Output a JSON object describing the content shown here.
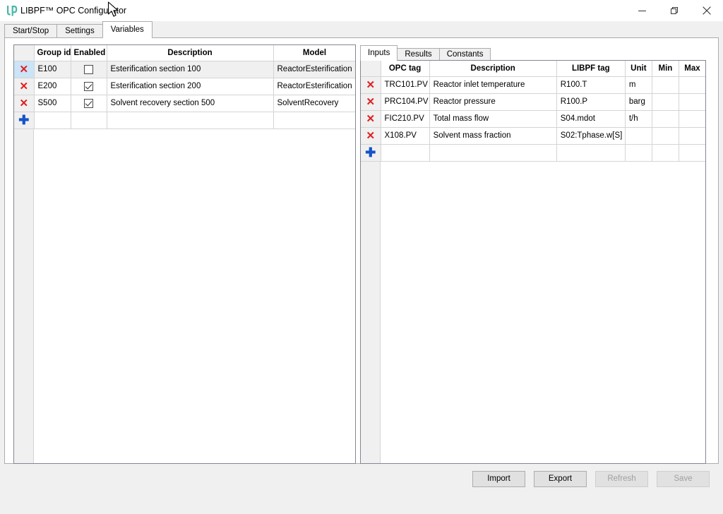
{
  "window": {
    "title": "LIBPF™ OPC Configurator",
    "logo_icon": "libpf-lp-logo-icon",
    "brand_color": "#49b6a8",
    "controls": {
      "minimize_label": "minimize-icon",
      "restore_label": "restore-icon",
      "close_label": "close-icon"
    }
  },
  "tabs": {
    "items": [
      {
        "label": "Start/Stop",
        "active": false
      },
      {
        "label": "Settings",
        "active": false
      },
      {
        "label": "Variables",
        "active": true
      }
    ]
  },
  "groups_grid": {
    "columns": [
      "Group id",
      "Enabled",
      "Description",
      "Model"
    ],
    "rows": [
      {
        "delete_icon": "✕",
        "group_id": "E100",
        "enabled": false,
        "description": "Esterification section 100",
        "model": "ReactorEsterification",
        "selected": true
      },
      {
        "delete_icon": "✕",
        "group_id": "E200",
        "enabled": true,
        "description": "Esterification section 200",
        "model": "ReactorEsterification",
        "selected": false
      },
      {
        "delete_icon": "✕",
        "group_id": "S500",
        "enabled": true,
        "description": "Solvent recovery section 500",
        "model": "SolventRecovery",
        "selected": false
      }
    ],
    "new_row_icon": "✚"
  },
  "variables_panel": {
    "tabs": [
      {
        "label": "Inputs",
        "active": true
      },
      {
        "label": "Results",
        "active": false
      },
      {
        "label": "Constants",
        "active": false
      }
    ],
    "columns": [
      "OPC tag",
      "Description",
      "LIBPF tag",
      "Unit",
      "Min",
      "Max"
    ],
    "rows": [
      {
        "delete_icon": "✕",
        "opc_tag": "TRC101.PV",
        "description": "Reactor inlet temperature",
        "libpf_tag": "R100.T",
        "unit": "m",
        "min": "",
        "max": ""
      },
      {
        "delete_icon": "✕",
        "opc_tag": "PRC104.PV",
        "description": "Reactor pressure",
        "libpf_tag": "R100.P",
        "unit": "barg",
        "min": "",
        "max": ""
      },
      {
        "delete_icon": "✕",
        "opc_tag": "FIC210.PV",
        "description": "Total mass flow",
        "libpf_tag": "S04.mdot",
        "unit": "t/h",
        "min": "",
        "max": ""
      },
      {
        "delete_icon": "✕",
        "opc_tag": "X108.PV",
        "description": "Solvent mass fraction",
        "libpf_tag": "S02:Tphase.w[S]",
        "unit": "",
        "min": "",
        "max": ""
      }
    ],
    "new_row_icon": "✚"
  },
  "footer": {
    "buttons": [
      {
        "label": "Import",
        "enabled": true
      },
      {
        "label": "Export",
        "enabled": true
      },
      {
        "label": "Refresh",
        "enabled": false
      },
      {
        "label": "Save",
        "enabled": false
      }
    ]
  }
}
